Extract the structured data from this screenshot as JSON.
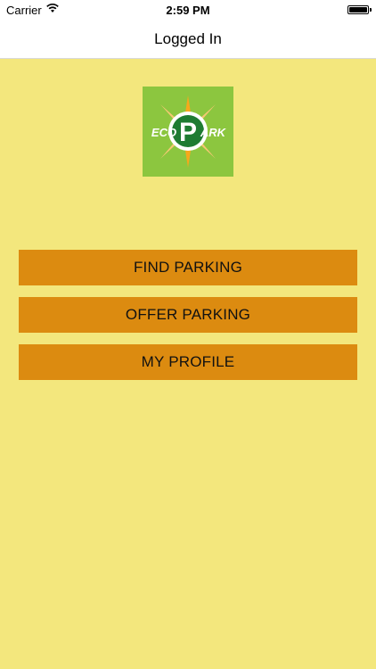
{
  "status_bar": {
    "carrier": "Carrier",
    "time": "2:59 PM",
    "wifi_icon": "wifi-icon",
    "battery_icon": "battery-icon"
  },
  "nav": {
    "title": "Logged In"
  },
  "logo": {
    "text_left": "ECO",
    "text_mid": "P",
    "text_right": "ARK",
    "icon": "ecopark-logo"
  },
  "menu": {
    "find_parking": "FIND PARKING",
    "offer_parking": "OFFER PARKING",
    "my_profile": "MY PROFILE"
  },
  "colors": {
    "background": "#f3e77d",
    "button": "#dc8b10",
    "logo_green": "#8cc63f",
    "logo_dark_green": "#1e7b32"
  }
}
